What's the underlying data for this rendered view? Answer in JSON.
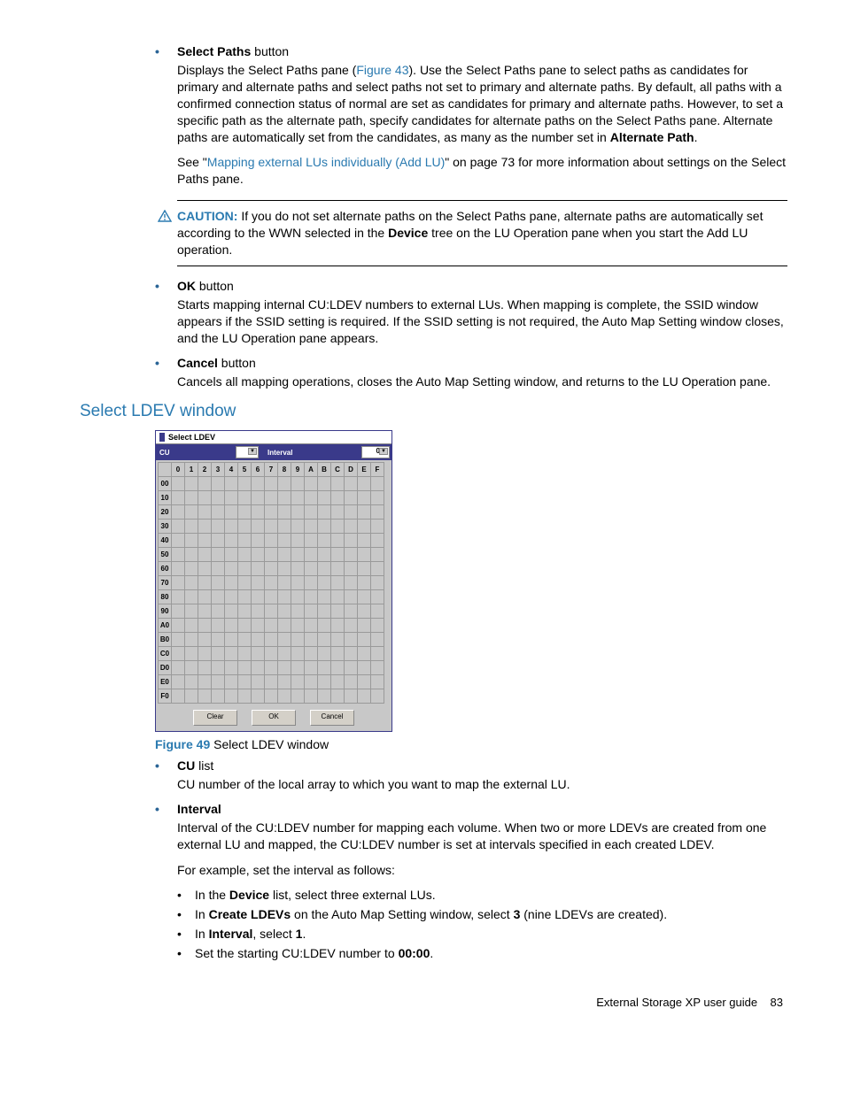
{
  "items": {
    "select_paths": {
      "title": "Select Paths",
      "title_suffix": " button",
      "p1a": "Displays the Select Paths pane (",
      "fig_ref": "Figure 43",
      "p1b": "). Use the Select Paths pane to select paths as candidates for primary and alternate paths and select paths not set to primary and alternate paths. By default, all paths with a confirmed connection status of normal are set as candidates for primary and alternate paths. However, to set a specific path as the alternate path, specify candidates for alternate paths on the Select Paths pane. Alternate paths are automatically set from the candidates, as many as the number set in ",
      "p1_bold": "Alternate Path",
      "p1c": ".",
      "p2a": "See \"",
      "p2_link": "Mapping external LUs individually (Add LU)",
      "p2b": "\" on page 73 for more information about settings on the Select Paths pane."
    },
    "caution": {
      "label": "CAUTION:",
      "t1": "If you do not set alternate paths on the Select Paths pane, alternate paths are automatically set according to the WWN selected in the ",
      "bold": "Device",
      "t2": " tree on the LU Operation pane when you start the Add LU operation."
    },
    "ok": {
      "title": "OK",
      "title_suffix": " button",
      "body": "Starts mapping internal CU:LDEV numbers to external LUs. When mapping is complete, the SSID window appears if the SSID setting is required. If the SSID setting is not required, the Auto Map Setting window closes, and the LU Operation pane appears."
    },
    "cancel": {
      "title": "Cancel",
      "title_suffix": " button",
      "body": "Cancels all mapping operations, closes the Auto Map Setting window, and returns to the LU Operation pane."
    }
  },
  "section_heading": "Select LDEV window",
  "dialog": {
    "title": "Select LDEV",
    "cu_label": "CU",
    "interval_label": "Interval",
    "interval_value": "0",
    "cols": [
      "0",
      "1",
      "2",
      "3",
      "4",
      "5",
      "6",
      "7",
      "8",
      "9",
      "A",
      "B",
      "C",
      "D",
      "E",
      "F"
    ],
    "rows": [
      "00",
      "10",
      "20",
      "30",
      "40",
      "50",
      "60",
      "70",
      "80",
      "90",
      "A0",
      "B0",
      "C0",
      "D0",
      "E0",
      "F0"
    ],
    "btn_clear": "Clear",
    "btn_ok": "OK",
    "btn_cancel": "Cancel"
  },
  "figure": {
    "label": "Figure 49",
    "caption": " Select LDEV window"
  },
  "lower": {
    "cu": {
      "title": "CU",
      "title_suffix": " list",
      "body": "CU number of the local array to which you want to map the external LU."
    },
    "interval": {
      "title": "Interval",
      "p1": "Interval of the CU:LDEV number for mapping each volume. When two or more LDEVs are created from one external LU and mapped, the CU:LDEV number is set at intervals specified in each created LDEV.",
      "p2": "For example, set the interval as follows:",
      "sub1a": "In the ",
      "sub1_bold": "Device",
      "sub1b": " list, select three external LUs.",
      "sub2a": "In ",
      "sub2_bold": "Create LDEVs",
      "sub2b": " on the Auto Map Setting window, select ",
      "sub2_bold2": "3",
      "sub2c": " (nine LDEVs are created).",
      "sub3a": "In ",
      "sub3_bold": "Interval",
      "sub3b": ", select ",
      "sub3_bold2": "1",
      "sub3c": ".",
      "sub4a": "Set the starting CU:LDEV number to ",
      "sub4_bold": "00:00",
      "sub4b": "."
    }
  },
  "footer": {
    "text": "External Storage XP user guide",
    "page": "83"
  }
}
